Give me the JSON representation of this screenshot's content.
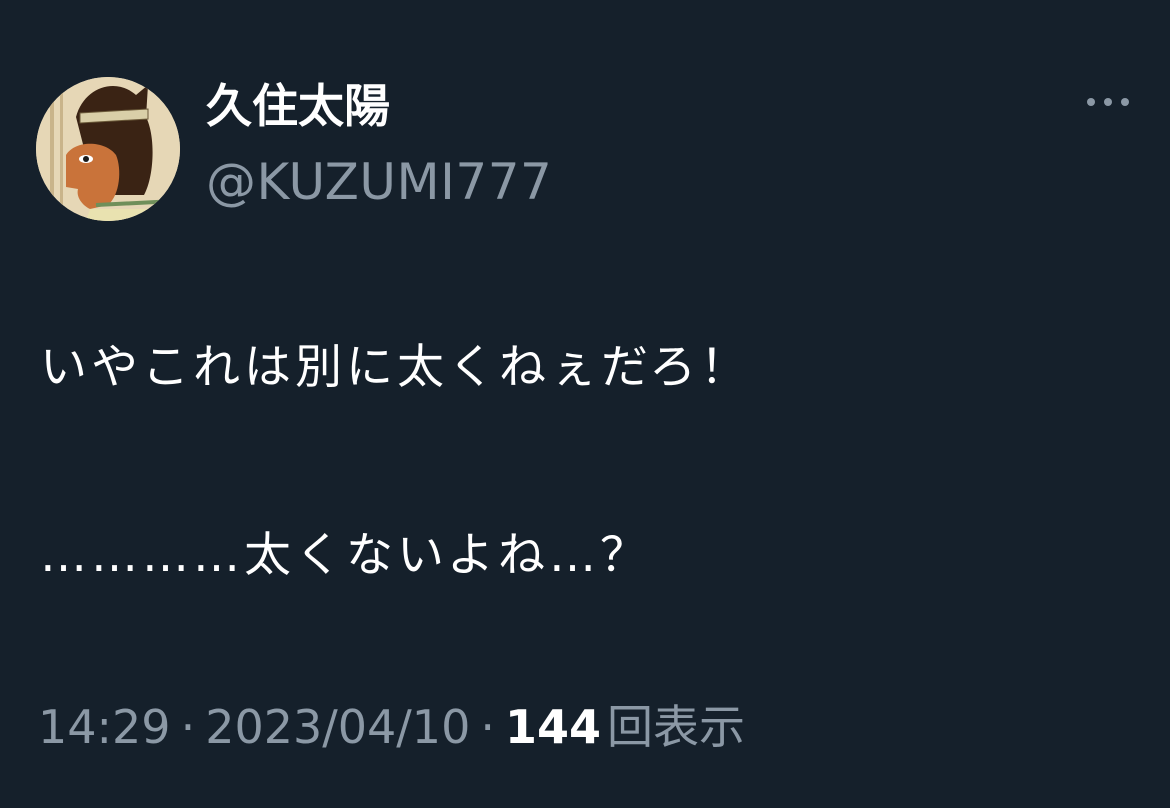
{
  "author": {
    "display_name": "久住太陽",
    "handle": "@KUZUMI777",
    "avatar_icon": "egyptian-portrait-avatar"
  },
  "more_icon": "more-horizontal-icon",
  "tweet": {
    "line1": "いやこれは別に太くねぇだろ！",
    "line2": "…………太くないよね…？"
  },
  "meta": {
    "time": "14:29",
    "separator": "·",
    "date": "2023/04/10",
    "views_count": "144",
    "views_label": "回表示"
  },
  "colors": {
    "background": "#15202b",
    "primary_text": "#ffffff",
    "secondary_text": "#8b98a5"
  }
}
